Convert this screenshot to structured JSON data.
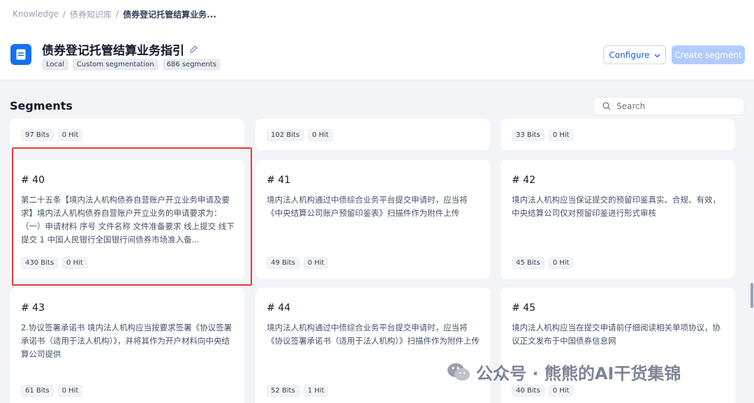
{
  "breadcrumb": {
    "root": "Knowledge",
    "separator": "/",
    "library": "债券知识库",
    "current": "债券登记托管结算业务..."
  },
  "document": {
    "icon": "document-icon",
    "title": "债券登记托管结算业务指引",
    "edit_icon": "edit-icon",
    "tags": [
      "Local",
      "Custom segmentation",
      "686 segments"
    ]
  },
  "toolbar": {
    "configure_label": "Configure",
    "create_label": "Create segment"
  },
  "segments": {
    "title": "Segments",
    "search_placeholder": "Search",
    "top_row": [
      {
        "bits": "97 Bits",
        "hits": "0 Hit"
      },
      {
        "bits": "102 Bits",
        "hits": "0 Hit"
      },
      {
        "bits": "33 Bits",
        "hits": "0 Hit"
      }
    ],
    "items": [
      {
        "number": "# 40",
        "content": "第二十五条【境内法人机构债券自营账户开立业务申请及要求】境内法人机构债券自营账户开立业务的申请要求为：（一）申请材料 序号 文件名称 文件准备要求 线上提交 线下提交 1 中国人民银行全国银行间债券市场准入备...",
        "bits": "430 Bits",
        "hits": "0 Hit"
      },
      {
        "number": "# 41",
        "content": "境内法人机构通过中债综合业务平台提交申请时，应当将《中央结算公司账户预留印鉴表》扫描件作为附件上传",
        "bits": "49 Bits",
        "hits": "0 Hit"
      },
      {
        "number": "# 42",
        "content": "境内法人机构应当保证提交的预留印鉴真实、合规、有效，中央结算公司仅对预留印鉴进行形式审核",
        "bits": "45 Bits",
        "hits": "0 Hit"
      },
      {
        "number": "# 43",
        "content": "2.协议签署承诺书 境内法人机构应当按要求签署《协议签署承诺书（适用于法人机构）》，并将其作为开户材料向中央结算公司提供",
        "bits": "61 Bits",
        "hits": "0 Hit"
      },
      {
        "number": "# 44",
        "content": "境内法人机构通过中债综合业务平台提交申请时，应当将《协议签署承诺书（适用于法人机构）》扫描件作为附件上传",
        "bits": "52 Bits",
        "hits": "1 Hit"
      },
      {
        "number": "# 45",
        "content": "境内法人机构应当在提交申请前仔细阅读相关单项协议，协议正文发布于中国债券信息网",
        "bits": "40 Bits",
        "hits": "0 Hit"
      }
    ]
  },
  "watermark": {
    "text": "公众号 · 熊熊的AI干货集锦"
  },
  "colors": {
    "accent": "#155eef",
    "doc_icon_bg": "#1570ef",
    "create_button_bg": "#b2ccff",
    "highlight_border": "#e53935",
    "page_bg": "#f2f4f7"
  }
}
